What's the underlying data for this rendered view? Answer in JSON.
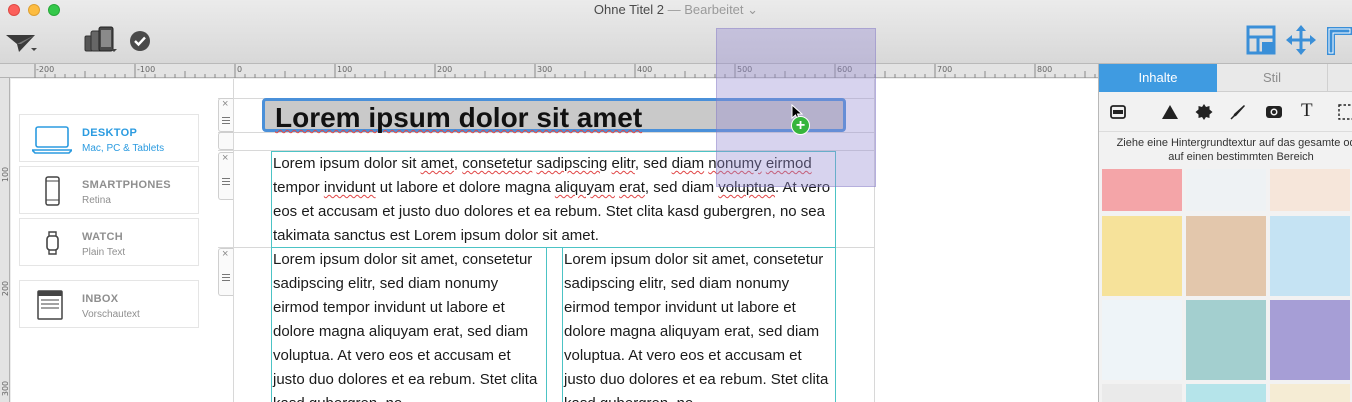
{
  "window": {
    "title": "Ohne Titel 2",
    "status": " — Bearbeitet",
    "status_chevron": "⌄"
  },
  "toolbar_icons": [
    "send-plane-icon",
    "devices-icon",
    "checkmark-icon",
    "layout-icon",
    "move-icon",
    "ruler-icon"
  ],
  "ruler": {
    "labels": [
      "-200",
      "-100",
      "0",
      "100",
      "200",
      "300",
      "400",
      "500",
      "600",
      "700",
      "800"
    ],
    "vertical_labels": [
      "100",
      "200",
      "300"
    ]
  },
  "devices": [
    {
      "name": "DESKTOP",
      "sub": "Mac, PC & Tablets",
      "active": true,
      "icon": "laptop-icon"
    },
    {
      "name": "SMARTPHONES",
      "sub": "Retina",
      "active": false,
      "icon": "smartphone-icon"
    },
    {
      "name": "WATCH",
      "sub": "Plain Text",
      "active": false,
      "icon": "watch-icon"
    },
    {
      "name": "INBOX",
      "sub": "Vorschautext",
      "active": false,
      "icon": "inbox-preview-icon"
    }
  ],
  "content": {
    "headline": "Lorem ipsum dolor sit amet",
    "paragraph": [
      {
        "t": "Lorem ipsum dolor sit "
      },
      {
        "t": "amet",
        "s": 1
      },
      {
        "t": ", "
      },
      {
        "t": "consetetur",
        "s": 1
      },
      {
        "t": " "
      },
      {
        "t": "sadipscing",
        "s": 1
      },
      {
        "t": " "
      },
      {
        "t": "elitr",
        "s": 1
      },
      {
        "t": ", sed "
      },
      {
        "t": "diam",
        "s": 1
      },
      {
        "t": " "
      },
      {
        "t": "nonumy",
        "s": 1
      },
      {
        "t": " "
      },
      {
        "t": "eirmod",
        "s": 1
      },
      {
        "t": " tempor "
      },
      {
        "t": "invidunt",
        "s": 1
      },
      {
        "t": " ut labore et dolore magna "
      },
      {
        "t": "aliquyam",
        "s": 1
      },
      {
        "t": " "
      },
      {
        "t": "erat",
        "s": 1
      },
      {
        "t": ", sed diam "
      },
      {
        "t": "voluptua",
        "s": 1
      },
      {
        "t": ". At vero eos et accusam et justo duo dolores et ea rebum. Stet clita kasd gubergren, no sea takimata sanctus est Lorem ipsum dolor sit amet."
      }
    ],
    "column_text": "Lorem ipsum dolor sit amet, consetetur sadipscing elitr, sed diam nonumy eirmod tempor invidunt ut labore et dolore magna aliquyam erat, sed diam voluptua. At vero eos et accusam et justo duo dolores et ea rebum. Stet clita kasd gubergren, no"
  },
  "drag_badge": "+",
  "panel": {
    "tab_active": "Inhalte",
    "tab_inactive": "Stil",
    "tools": [
      "block-icon",
      "triangle-icon",
      "badge-icon",
      "pen-icon",
      "image-icon",
      "text-icon",
      "selection-icon"
    ],
    "tool_text_glyph": "T",
    "hint": "Ziehe eine Hintergrundtextur auf das gesamte oder auf einen bestimmten Bereich",
    "swatches": [
      "#f4a5a8",
      "#eef2f4",
      "#f6e6da",
      "#f6e29a",
      "#e3c7ac",
      "#c5e3f3",
      "#eef4f8",
      "#a3cfcf",
      "#a69ed6",
      "#eaeaea",
      "#b5e4ea",
      "#f5ecd4"
    ]
  },
  "colors": {
    "accent": "#3f9be1",
    "selection": "#4a90d9",
    "block_border": "#4cc3c5",
    "drag_overlay": "#968cd2",
    "badge": "#36b53c"
  }
}
